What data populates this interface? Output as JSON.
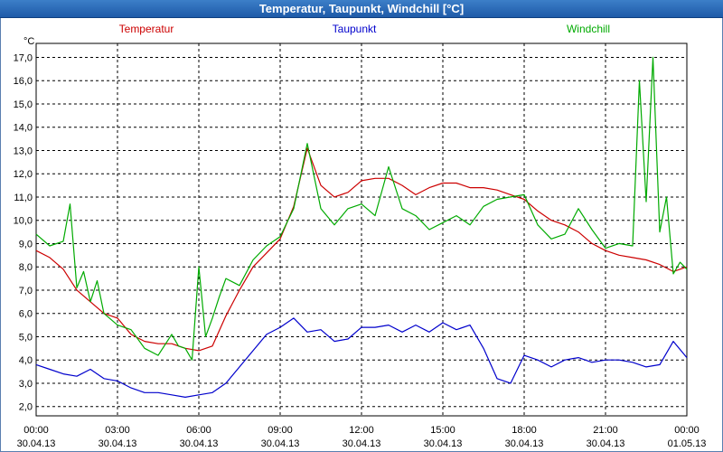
{
  "window": {
    "title": "Temperatur, Taupunkt, Windchill [°C]"
  },
  "colors": {
    "Temperatur": "#cc0000",
    "Taupunkt": "#0000cc",
    "Windchill": "#00aa00",
    "grid": "#000000",
    "titlebar": "#2a6ab8"
  },
  "chart_data": {
    "type": "line",
    "title": "Temperatur, Taupunkt, Windchill [°C]",
    "ylabel": "°C",
    "xlabel": "",
    "ylim": [
      1.6,
      17.6
    ],
    "xlim": [
      0,
      24
    ],
    "grid": true,
    "legend": "top",
    "y_ticks": [
      "2,0",
      "3,0",
      "4,0",
      "5,0",
      "6,0",
      "7,0",
      "8,0",
      "9,0",
      "10,0",
      "11,0",
      "12,0",
      "13,0",
      "14,0",
      "15,0",
      "16,0",
      "17,0"
    ],
    "x_ticks": [
      {
        "time": "00:00",
        "date": "30.04.13"
      },
      {
        "time": "03:00",
        "date": "30.04.13"
      },
      {
        "time": "06:00",
        "date": "30.04.13"
      },
      {
        "time": "09:00",
        "date": "30.04.13"
      },
      {
        "time": "12:00",
        "date": "30.04.13"
      },
      {
        "time": "15:00",
        "date": "30.04.13"
      },
      {
        "time": "18:00",
        "date": "30.04.13"
      },
      {
        "time": "21:00",
        "date": "30.04.13"
      },
      {
        "time": "00:00",
        "date": "01.05.13"
      }
    ],
    "series": [
      {
        "name": "Temperatur",
        "color": "#cc0000",
        "x": [
          0,
          0.5,
          1,
          1.5,
          2,
          2.5,
          3,
          3.5,
          4,
          4.5,
          5,
          5.5,
          6,
          6.5,
          7,
          7.5,
          8,
          8.5,
          9,
          9.5,
          10,
          10.5,
          11,
          11.5,
          12,
          12.5,
          13,
          13.5,
          14,
          14.5,
          15,
          15.5,
          16,
          16.5,
          17,
          17.5,
          18,
          18.5,
          19,
          19.5,
          20,
          20.5,
          21,
          21.5,
          22,
          22.5,
          23,
          23.5,
          24
        ],
        "values": [
          8.7,
          8.4,
          7.9,
          7.0,
          6.5,
          6.0,
          5.8,
          5.1,
          4.8,
          4.7,
          4.7,
          4.5,
          4.4,
          4.6,
          5.9,
          7.0,
          8.0,
          8.6,
          9.2,
          10.6,
          13.1,
          11.5,
          11.0,
          11.2,
          11.7,
          11.8,
          11.8,
          11.5,
          11.1,
          11.4,
          11.6,
          11.6,
          11.4,
          11.4,
          11.3,
          11.1,
          10.9,
          10.4,
          10.0,
          9.8,
          9.5,
          9.0,
          8.7,
          8.5,
          8.4,
          8.3,
          8.1,
          7.8,
          8.0
        ]
      },
      {
        "name": "Taupunkt",
        "color": "#0000cc",
        "x": [
          0,
          0.5,
          1,
          1.5,
          2,
          2.5,
          3,
          3.5,
          4,
          4.5,
          5,
          5.5,
          6,
          6.5,
          7,
          7.5,
          8,
          8.5,
          9,
          9.5,
          10,
          10.5,
          11,
          11.5,
          12,
          12.5,
          13,
          13.5,
          14,
          14.5,
          15,
          15.5,
          16,
          16.5,
          17,
          17.5,
          18,
          18.5,
          19,
          19.5,
          20,
          20.5,
          21,
          21.5,
          22,
          22.5,
          23,
          23.5,
          24
        ],
        "values": [
          3.8,
          3.6,
          3.4,
          3.3,
          3.6,
          3.2,
          3.1,
          2.8,
          2.6,
          2.6,
          2.5,
          2.4,
          2.5,
          2.6,
          3.0,
          3.7,
          4.4,
          5.1,
          5.4,
          5.8,
          5.2,
          5.3,
          4.8,
          4.9,
          5.4,
          5.4,
          5.5,
          5.2,
          5.5,
          5.2,
          5.6,
          5.3,
          5.5,
          4.5,
          3.2,
          3.0,
          4.2,
          4.0,
          3.7,
          4.0,
          4.1,
          3.9,
          4.0,
          4.0,
          3.9,
          3.7,
          3.8,
          4.8,
          4.1
        ]
      },
      {
        "name": "Windchill",
        "color": "#00aa00",
        "x": [
          0,
          0.5,
          1,
          1.25,
          1.5,
          1.75,
          2,
          2.25,
          2.5,
          3,
          3.5,
          4,
          4.5,
          5,
          5.25,
          5.5,
          5.75,
          6,
          6.25,
          6.5,
          6.75,
          7,
          7.5,
          8,
          8.5,
          9,
          9.5,
          10,
          10.5,
          11,
          11.5,
          12,
          12.5,
          13,
          13.5,
          14,
          14.5,
          15,
          15.5,
          16,
          16.5,
          17,
          17.5,
          18,
          18.5,
          19,
          19.5,
          20,
          20.5,
          21,
          21.5,
          22,
          22.25,
          22.5,
          22.75,
          23,
          23.25,
          23.5,
          23.75,
          24
        ],
        "values": [
          9.4,
          8.9,
          9.1,
          10.7,
          7.1,
          7.8,
          6.5,
          7.4,
          6.0,
          5.5,
          5.3,
          4.5,
          4.2,
          5.1,
          4.6,
          4.5,
          4.0,
          8.0,
          5.0,
          5.8,
          6.7,
          7.5,
          7.2,
          8.3,
          8.9,
          9.3,
          10.5,
          13.3,
          10.5,
          9.8,
          10.5,
          10.7,
          10.2,
          12.3,
          10.5,
          10.2,
          9.6,
          9.9,
          10.2,
          9.8,
          10.6,
          10.9,
          11.0,
          11.1,
          9.8,
          9.2,
          9.4,
          10.5,
          9.6,
          8.8,
          9.0,
          8.9,
          16.0,
          10.8,
          17.0,
          9.5,
          11.0,
          7.7,
          8.2,
          7.9
        ]
      }
    ]
  }
}
